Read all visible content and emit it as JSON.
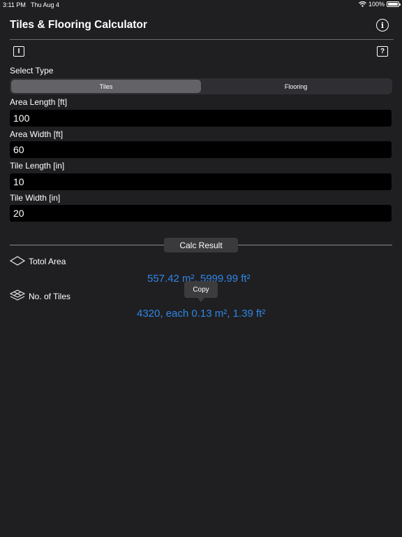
{
  "status_bar": {
    "time": "3:11 PM",
    "date": "Thu Aug 4",
    "battery": "100%"
  },
  "header": {
    "title": "Tiles & Flooring Calculator",
    "info_icon": "i",
    "left_icon": "I",
    "help_icon": "?"
  },
  "type_select": {
    "label": "Select Type",
    "options": [
      "Tiles",
      "Flooring"
    ],
    "selected": "Tiles"
  },
  "fields": {
    "area_length": {
      "label": "Area Length [ft]",
      "value": "100"
    },
    "area_width": {
      "label": "Area Width [ft]",
      "value": "60"
    },
    "tile_length": {
      "label": "Tile Length [in]",
      "value": "10"
    },
    "tile_width": {
      "label": "Tile Width [in]",
      "value": "20"
    }
  },
  "calc": {
    "button_label": "Calc Result"
  },
  "results": {
    "total_area": {
      "label": "Totol Area",
      "value": "557.42 m², 5999.99 ft²"
    },
    "num_tiles": {
      "label": "No. of Tiles",
      "value": "4320, each 0.13 m², 1.39 ft²"
    }
  },
  "copy_tooltip": "Copy",
  "colors": {
    "background": "#1f1f21",
    "accent": "#2f86e6",
    "field_bg": "#000000"
  }
}
